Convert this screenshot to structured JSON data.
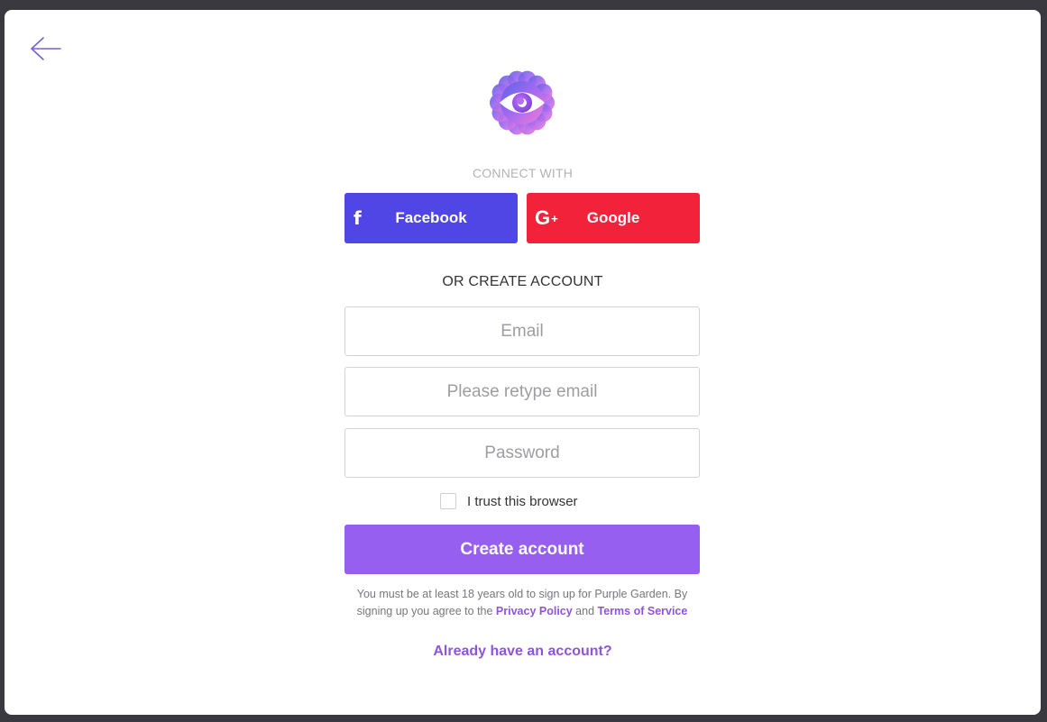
{
  "connect": {
    "label": "CONNECT WITH",
    "facebook_label": "Facebook",
    "facebook_icon": "f",
    "google_label": "Google",
    "google_icon": "G",
    "google_icon_plus": "+"
  },
  "form": {
    "or_label": "OR CREATE ACCOUNT",
    "email_placeholder": "Email",
    "retype_placeholder": "Please retype email",
    "password_placeholder": "Password",
    "trust_label": "I trust this browser",
    "trust_checked": false,
    "submit_label": "Create account"
  },
  "legal": {
    "text_1": "You must be at least 18 years old to sign up for Purple Garden. By signing up you agree to the ",
    "privacy_link": "Privacy Policy",
    "and": " and ",
    "terms_link": "Terms of Service"
  },
  "footer": {
    "login_link": "Already have an account?"
  },
  "colors": {
    "facebook": "#5046e5",
    "google": "#f3223b",
    "accent": "#975ff0",
    "link": "#8f55d8"
  },
  "icons": {
    "back": "arrow-left-icon",
    "logo": "purple-garden-eye-flower-logo"
  }
}
